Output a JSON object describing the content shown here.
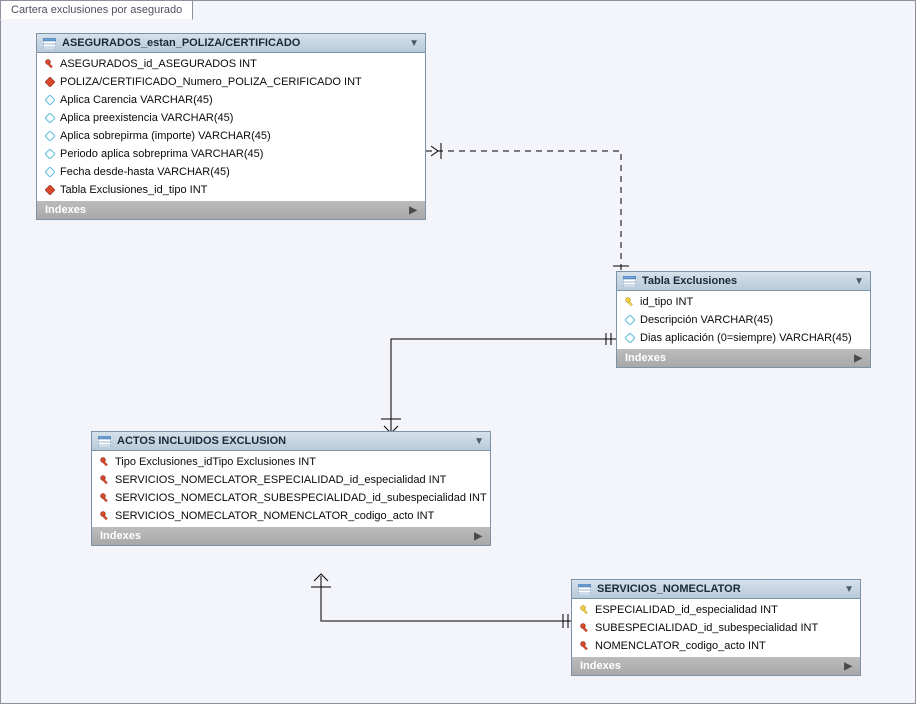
{
  "tab_label": "Cartera exclusiones por asegurado",
  "indexes_label": "Indexes",
  "arrow_glyph": "▶",
  "down_arrow_glyph": "▼",
  "tables": {
    "asegurados": {
      "title": "ASEGURADOS_estan_POLIZA/CERTIFICADO",
      "columns": [
        {
          "icon": "pk-red",
          "text": "ASEGURADOS_id_ASEGURADOS INT"
        },
        {
          "icon": "fk-red",
          "text": "POLIZA/CERTIFICADO_Numero_POLIZA_CERIFICADO INT"
        },
        {
          "icon": "dia",
          "text": "Aplica Carencia VARCHAR(45)"
        },
        {
          "icon": "dia",
          "text": "Aplica preexistencia VARCHAR(45)"
        },
        {
          "icon": "dia",
          "text": "Aplica sobrepirma (importe) VARCHAR(45)"
        },
        {
          "icon": "dia",
          "text": "Periodo aplica sobreprima VARCHAR(45)"
        },
        {
          "icon": "dia",
          "text": "Fecha desde-hasta VARCHAR(45)"
        },
        {
          "icon": "fk-red",
          "text": "Tabla Exclusiones_id_tipo INT"
        }
      ]
    },
    "exclusiones": {
      "title": "Tabla Exclusiones",
      "columns": [
        {
          "icon": "pk-yellow",
          "text": "id_tipo INT"
        },
        {
          "icon": "dia",
          "text": "Descripción VARCHAR(45)"
        },
        {
          "icon": "dia",
          "text": "Dias aplicación (0=siempre) VARCHAR(45)"
        }
      ]
    },
    "actos": {
      "title": "ACTOS INCLUIDOS EXCLUSION",
      "columns": [
        {
          "icon": "pk-red",
          "text": "Tipo Exclusiones_idTipo Exclusiones INT"
        },
        {
          "icon": "pk-red",
          "text": "SERVICIOS_NOMECLATOR_ESPECIALIDAD_id_especialidad INT"
        },
        {
          "icon": "pk-red",
          "text": "SERVICIOS_NOMECLATOR_SUBESPECIALIDAD_id_subespecialidad INT"
        },
        {
          "icon": "pk-red",
          "text": "SERVICIOS_NOMECLATOR_NOMENCLATOR_codigo_acto INT"
        }
      ]
    },
    "servicios": {
      "title": "SERVICIOS_NOMECLATOR",
      "columns": [
        {
          "icon": "pk-yellow",
          "text": "ESPECIALIDAD_id_especialidad INT"
        },
        {
          "icon": "pk-red",
          "text": "SUBESPECIALIDAD_id_subespecialidad INT"
        },
        {
          "icon": "pk-red",
          "text": "NOMENCLATOR_codigo_acto INT"
        }
      ]
    }
  }
}
